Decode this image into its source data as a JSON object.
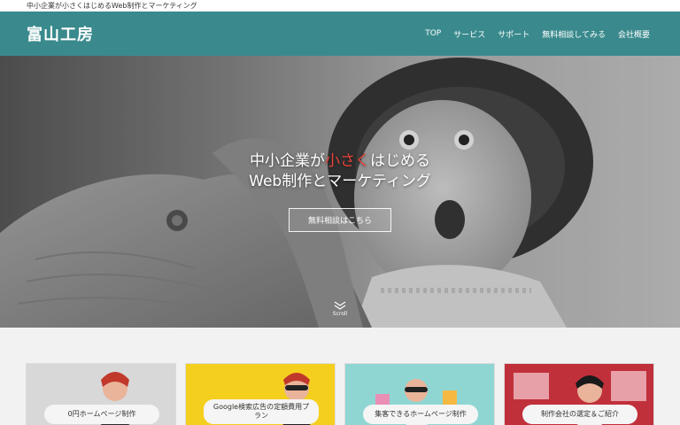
{
  "topbar": {
    "tagline": "中小企業が小さくはじめるWeb制作とマーケティング"
  },
  "header": {
    "logo_text": "富山工房",
    "nav": [
      "TOP",
      "サービス",
      "サポート",
      "無料相談してみる",
      "会社概要"
    ]
  },
  "hero": {
    "line1_before": "中小企業が",
    "line1_highlight": "小さく",
    "line1_after": "はじめる",
    "line2": "Web制作とマーケティング",
    "cta": "無料相談はこちら",
    "scroll": "Scroll"
  },
  "cards": [
    {
      "label": "0円ホームページ制作"
    },
    {
      "label": "Google検索広告の定額費用プラン"
    },
    {
      "label": "集客できるホームページ制作"
    },
    {
      "label": "制作会社の選定＆ご紹介"
    }
  ],
  "colors": {
    "header": "#3a8a8d",
    "highlight": "#e8433a",
    "card2": "#f5cf1e",
    "card3": "#8fd6d3",
    "card4": "#c0303b"
  }
}
